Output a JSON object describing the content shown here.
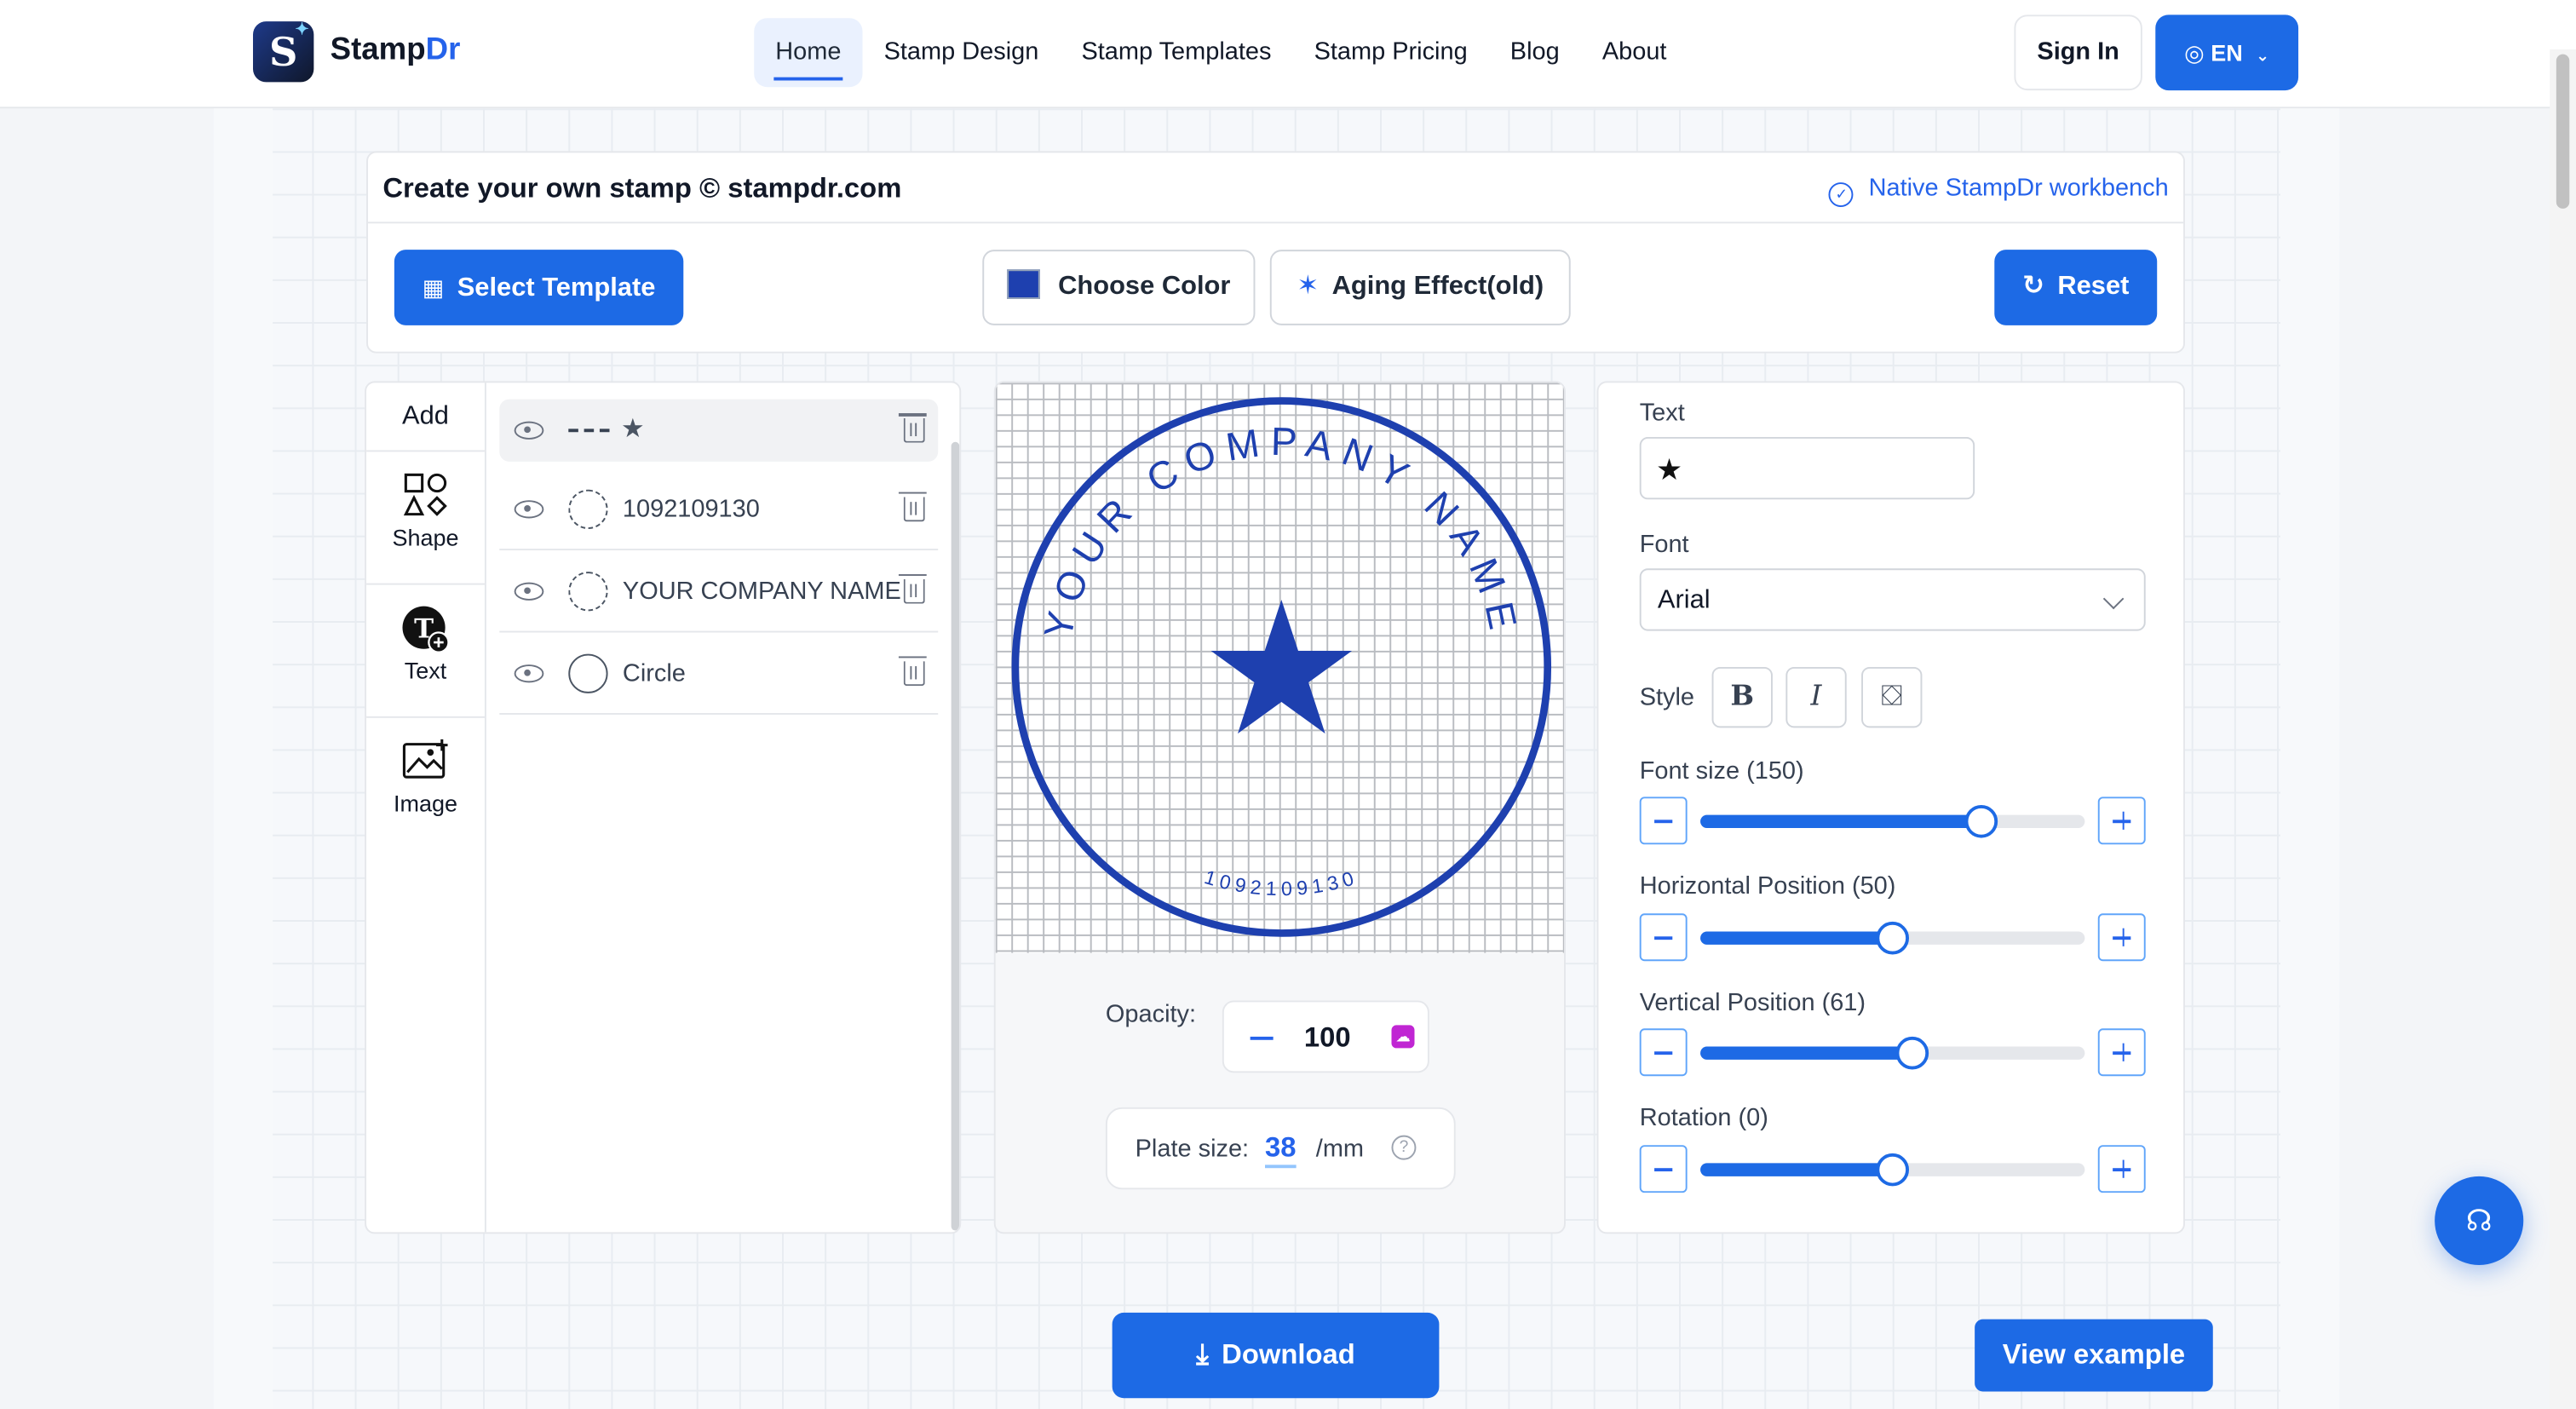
{
  "header": {
    "logo_text_main": "Stamp",
    "logo_text_accent": "Dr",
    "nav": [
      {
        "label": "Home",
        "active": true
      },
      {
        "label": "Stamp Design"
      },
      {
        "label": "Stamp Templates"
      },
      {
        "label": "Stamp Pricing"
      },
      {
        "label": "Blog"
      },
      {
        "label": "About"
      }
    ],
    "signin_label": "Sign In",
    "language_label": "EN"
  },
  "toolbar": {
    "title": "Create your own stamp © stampdr.com",
    "native_label": "Native StampDr workbench",
    "select_template_label": "Select Template",
    "choose_color_label": "Choose Color",
    "aging_label": "Aging Effect(old)",
    "reset_label": "Reset",
    "current_color": "#1e40af"
  },
  "add_panel": {
    "heading": "Add",
    "tools": [
      {
        "label": "Shape",
        "icon": "shapes-icon"
      },
      {
        "label": "Text",
        "icon": "text-add-icon"
      },
      {
        "label": "Image",
        "icon": "image-add-icon"
      }
    ]
  },
  "layers": [
    {
      "label": "★",
      "selected": true,
      "thumb": "dash-line"
    },
    {
      "label": "1092109130",
      "thumb": "dashed-circle"
    },
    {
      "label": "YOUR COMPANY NAME",
      "thumb": "dashed-circle"
    },
    {
      "label": "Circle",
      "thumb": "solid-circle"
    }
  ],
  "stamp": {
    "top_text": "YOUR COMPANY NAME",
    "bottom_text": "1092109130",
    "center_symbol": "★",
    "color": "#1e40af"
  },
  "canvas_controls": {
    "opacity_label": "Opacity:",
    "opacity_value": "100",
    "plate_label": "Plate size:",
    "plate_value": "38",
    "plate_unit": "/mm"
  },
  "properties": {
    "text_label": "Text",
    "text_value": "★",
    "font_label": "Font",
    "font_value": "Arial",
    "style_label": "Style",
    "sliders": [
      {
        "label": "Font size (150)",
        "fraction": 0.73
      },
      {
        "label": "Horizontal Position (50)",
        "fraction": 0.5
      },
      {
        "label": "Vertical Position (61)",
        "fraction": 0.55
      },
      {
        "label": "Rotation (0)",
        "fraction": 0.5
      }
    ]
  },
  "footer": {
    "download_label": "Download",
    "view_example_label": "View example"
  }
}
